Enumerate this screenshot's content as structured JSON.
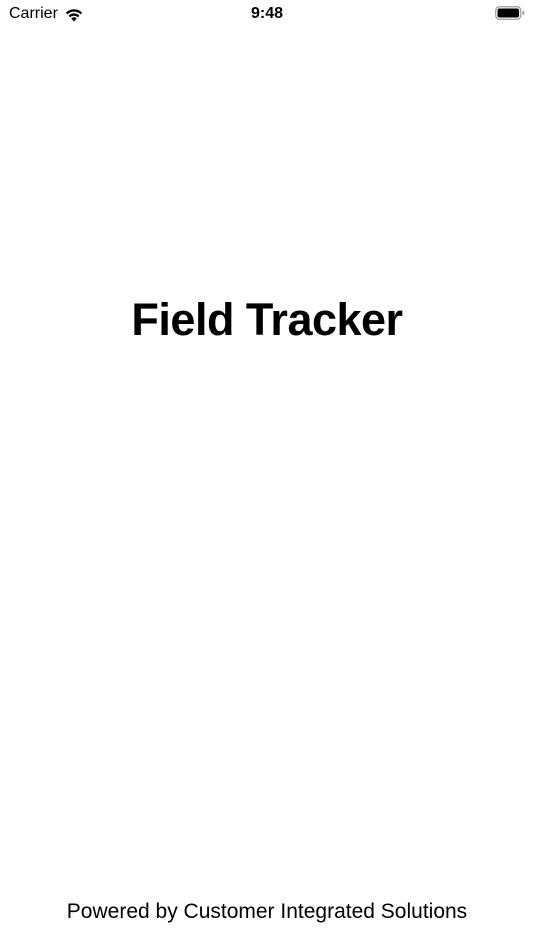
{
  "status_bar": {
    "carrier": "Carrier",
    "time": "9:48",
    "wifi_icon": "wifi-icon",
    "battery_icon": "battery-icon"
  },
  "splash": {
    "title": "Field Tracker",
    "footer": "Powered by Customer Integrated Solutions"
  },
  "colors": {
    "background": "#ffffff",
    "text": "#000000"
  }
}
